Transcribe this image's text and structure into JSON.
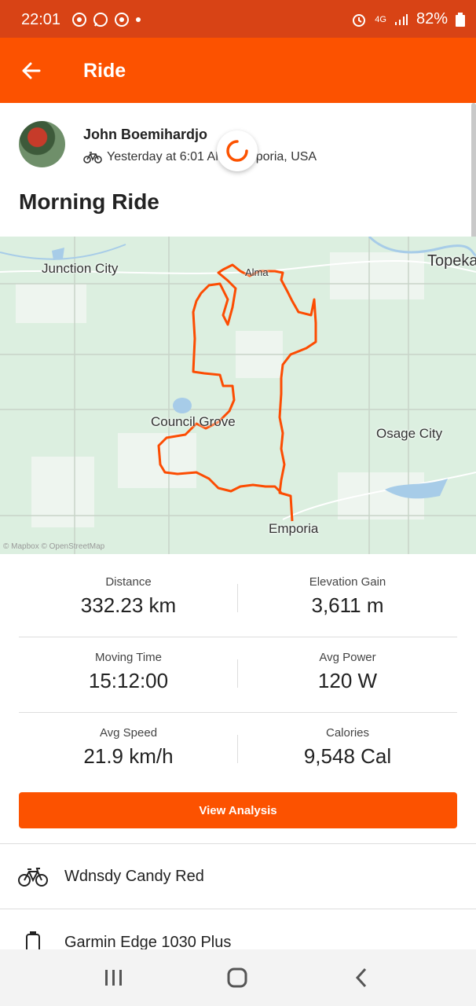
{
  "status_bar": {
    "time": "22:01",
    "network": "4G",
    "battery": "82%"
  },
  "app_bar": {
    "title": "Ride"
  },
  "athlete": {
    "name": "John Boemihardjo",
    "meta": "Yesterday at 6:01 AM · Emporia, USA"
  },
  "activity": {
    "title": "Morning Ride"
  },
  "map": {
    "cities": [
      "Junction City",
      "Topeka",
      "Alma",
      "Council Grove",
      "Osage City",
      "Emporia"
    ],
    "attribution": "© Mapbox © OpenStreetMap"
  },
  "stats": [
    {
      "label": "Distance",
      "value": "332.23 km"
    },
    {
      "label": "Elevation Gain",
      "value": "3,611 m"
    },
    {
      "label": "Moving Time",
      "value": "15:12:00"
    },
    {
      "label": "Avg Power",
      "value": "120 W"
    },
    {
      "label": "Avg Speed",
      "value": "21.9 km/h"
    },
    {
      "label": "Calories",
      "value": "9,548 Cal"
    }
  ],
  "actions": {
    "view_analysis": "View Analysis"
  },
  "gear": {
    "bike": "Wdnsdy Candy Red",
    "device": "Garmin Edge 1030 Plus"
  },
  "colors": {
    "brand": "#fc5200",
    "status_bar": "#d84315",
    "route": "#fc5200"
  }
}
